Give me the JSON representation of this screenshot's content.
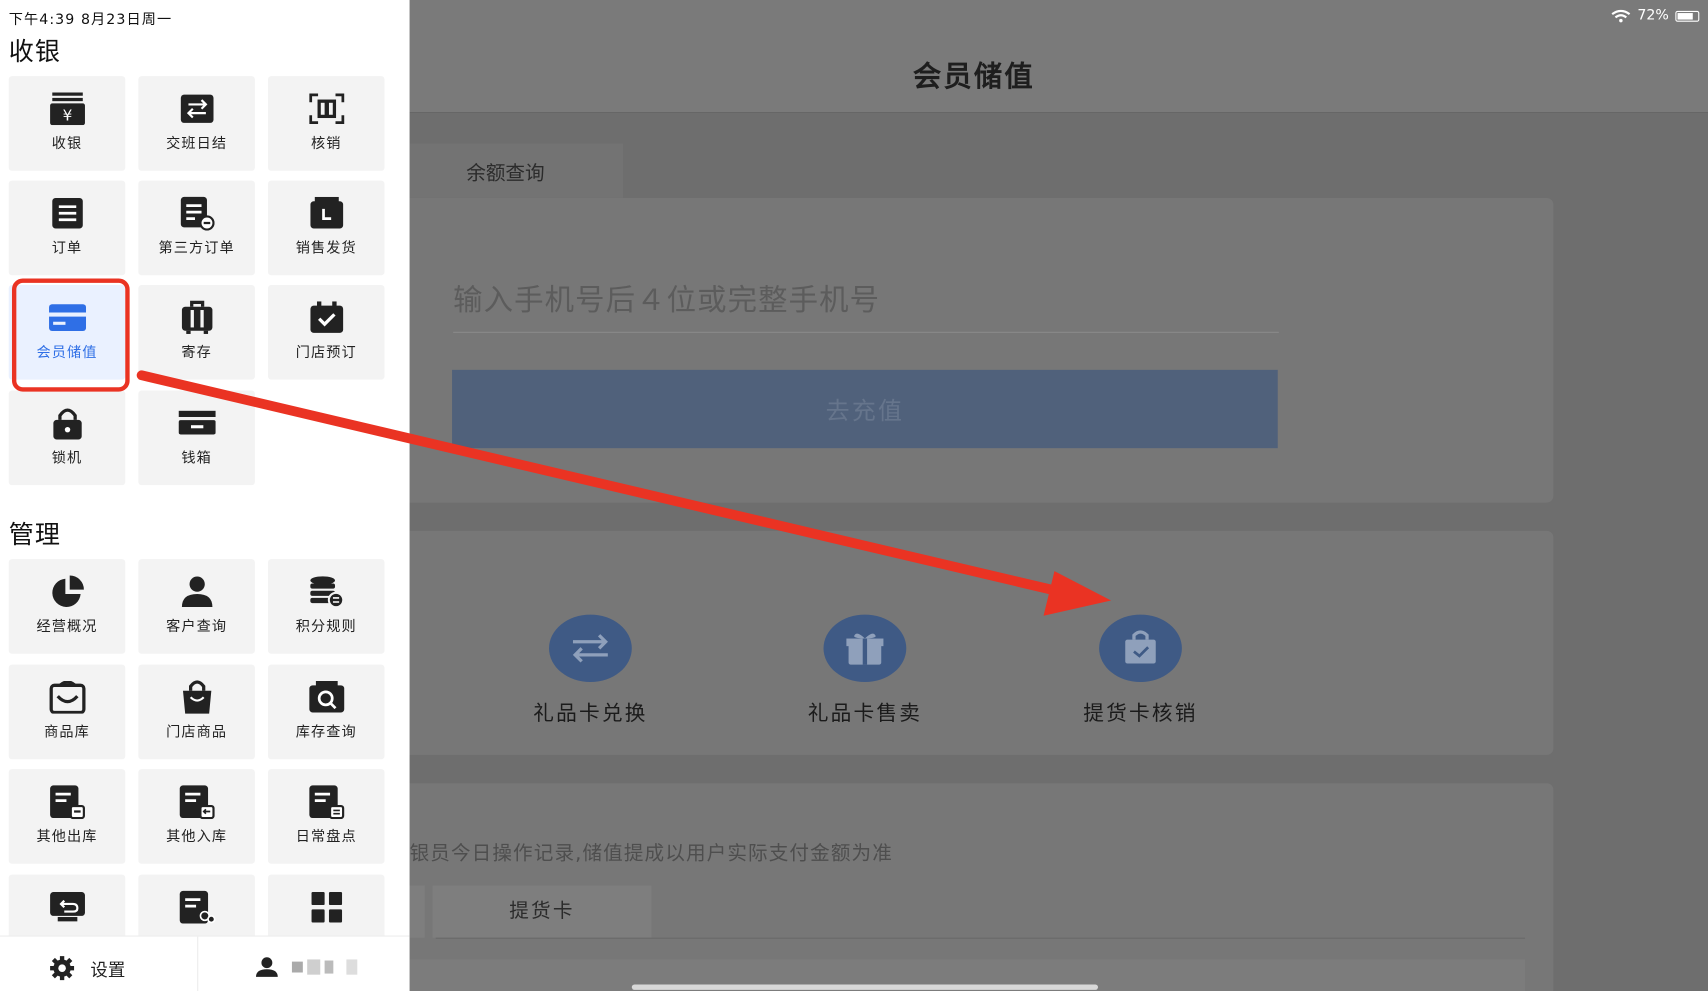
{
  "status_bar": {
    "time_date": "下午4:39   8月23日周一",
    "battery": "72%"
  },
  "drawer": {
    "section_cashier": "收银",
    "section_manage": "管理",
    "cashier_items": [
      {
        "label": "收银",
        "icon": "cash-register-icon"
      },
      {
        "label": "交班日结",
        "icon": "shift-swap-icon"
      },
      {
        "label": "核销",
        "icon": "scan-verify-icon"
      },
      {
        "label": "订单",
        "icon": "order-list-icon"
      },
      {
        "label": "第三方订单",
        "icon": "third-party-order-icon"
      },
      {
        "label": "销售发货",
        "icon": "sales-shipping-icon"
      },
      {
        "label": "会员储值",
        "icon": "member-card-icon"
      },
      {
        "label": "寄存",
        "icon": "luggage-storage-icon"
      },
      {
        "label": "门店预订",
        "icon": "calendar-check-icon"
      },
      {
        "label": "锁机",
        "icon": "lock-icon"
      },
      {
        "label": "钱箱",
        "icon": "cash-drawer-icon"
      }
    ],
    "manage_items": [
      {
        "label": "经营概况",
        "icon": "pie-chart-icon"
      },
      {
        "label": "客户查询",
        "icon": "person-icon"
      },
      {
        "label": "积分规则",
        "icon": "coins-stack-icon"
      },
      {
        "label": "商品库",
        "icon": "product-library-icon"
      },
      {
        "label": "门店商品",
        "icon": "shopping-bag-icon"
      },
      {
        "label": "库存查询",
        "icon": "inventory-search-icon"
      },
      {
        "label": "其他出库",
        "icon": "stock-out-icon"
      },
      {
        "label": "其他入库",
        "icon": "stock-in-icon"
      },
      {
        "label": "日常盘点",
        "icon": "stocktake-icon"
      },
      {
        "label": "",
        "icon": "return-icon"
      },
      {
        "label": "",
        "icon": "document-group-icon"
      },
      {
        "label": "",
        "icon": "grid-icon"
      }
    ],
    "settings_label": "设置"
  },
  "main": {
    "title": "会员储值",
    "tab_balance": "余额查询",
    "phone_placeholder": "输入手机号后４位或完整手机号",
    "recharge_button": "去充值",
    "functions": [
      {
        "label": "礼品卡兑换",
        "icon": "exchange-arrows-icon"
      },
      {
        "label": "礼品卡售卖",
        "icon": "gift-icon"
      },
      {
        "label": "提货卡核销",
        "icon": "bag-check-icon"
      }
    ],
    "notice": "银员今日操作记录,储值提成以用户实际支付金额为准",
    "tab_pickup": "提货卡"
  },
  "colors": {
    "highlight": "#ea3323",
    "accent": "#2f6fe6",
    "button": "#50617b"
  }
}
